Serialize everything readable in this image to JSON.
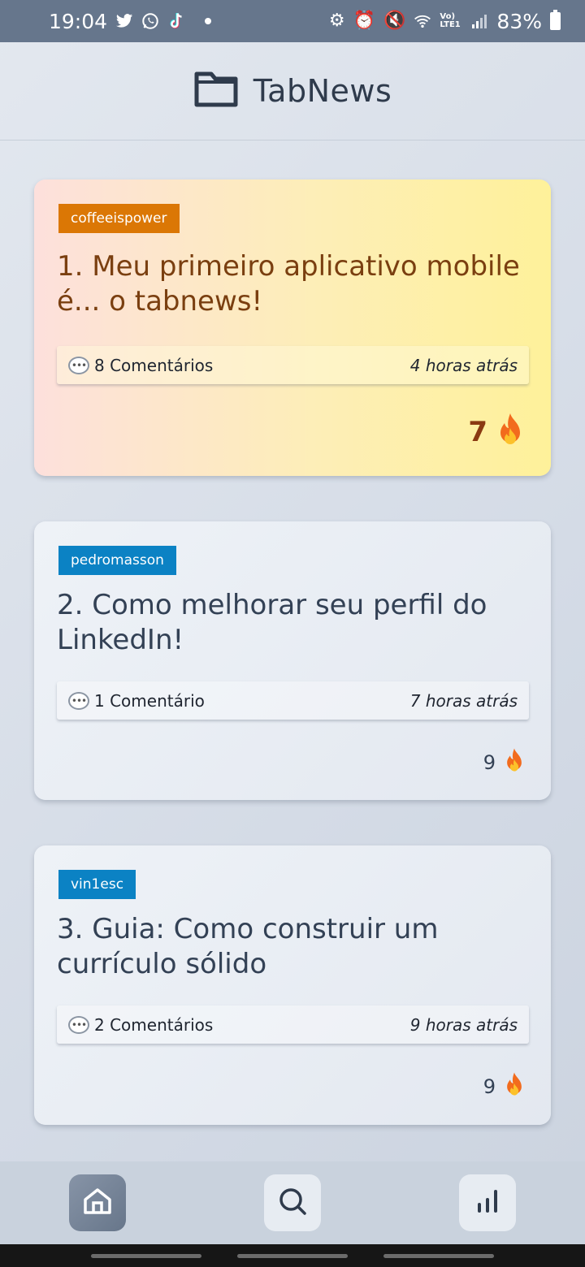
{
  "status_bar": {
    "time": "19:04",
    "battery": "83%",
    "network_label": "Vo) LTE1",
    "left_icons": [
      "twitter-icon",
      "whatsapp-icon",
      "tiktok-icon",
      "dot-icon"
    ],
    "right_icons": [
      "battery-saver-icon",
      "alarm-icon",
      "mute-icon",
      "wifi-icon",
      "signal-icon",
      "battery-icon"
    ]
  },
  "header": {
    "title": "TabNews",
    "icon": "folder-icon"
  },
  "posts": [
    {
      "author": "coffeeispower",
      "title": "1. Meu primeiro aplicativo mobile é... o tabnews!",
      "comments": "8 Comentários",
      "time": "4 horas atrás",
      "votes": "7",
      "badge_color": "#db7705",
      "featured": true
    },
    {
      "author": "pedromasson",
      "title": "2. Como melhorar seu perfil do LinkedIn!",
      "comments": "1 Comentário",
      "time": "7 horas atrás",
      "votes": "9",
      "badge_color": "#0b82c4",
      "featured": false
    },
    {
      "author": "vin1esc",
      "title": "3. Guia: Como construir um currículo sólido",
      "comments": "2 Comentários",
      "time": "9 horas atrás",
      "votes": "9",
      "badge_color": "#0b82c4",
      "featured": false
    }
  ],
  "nav": {
    "items": [
      "home-icon",
      "search-icon",
      "chart-icon"
    ],
    "active": "home-icon"
  },
  "colors": {
    "status_bar": "#66768c",
    "fire": "#f26b1d"
  }
}
